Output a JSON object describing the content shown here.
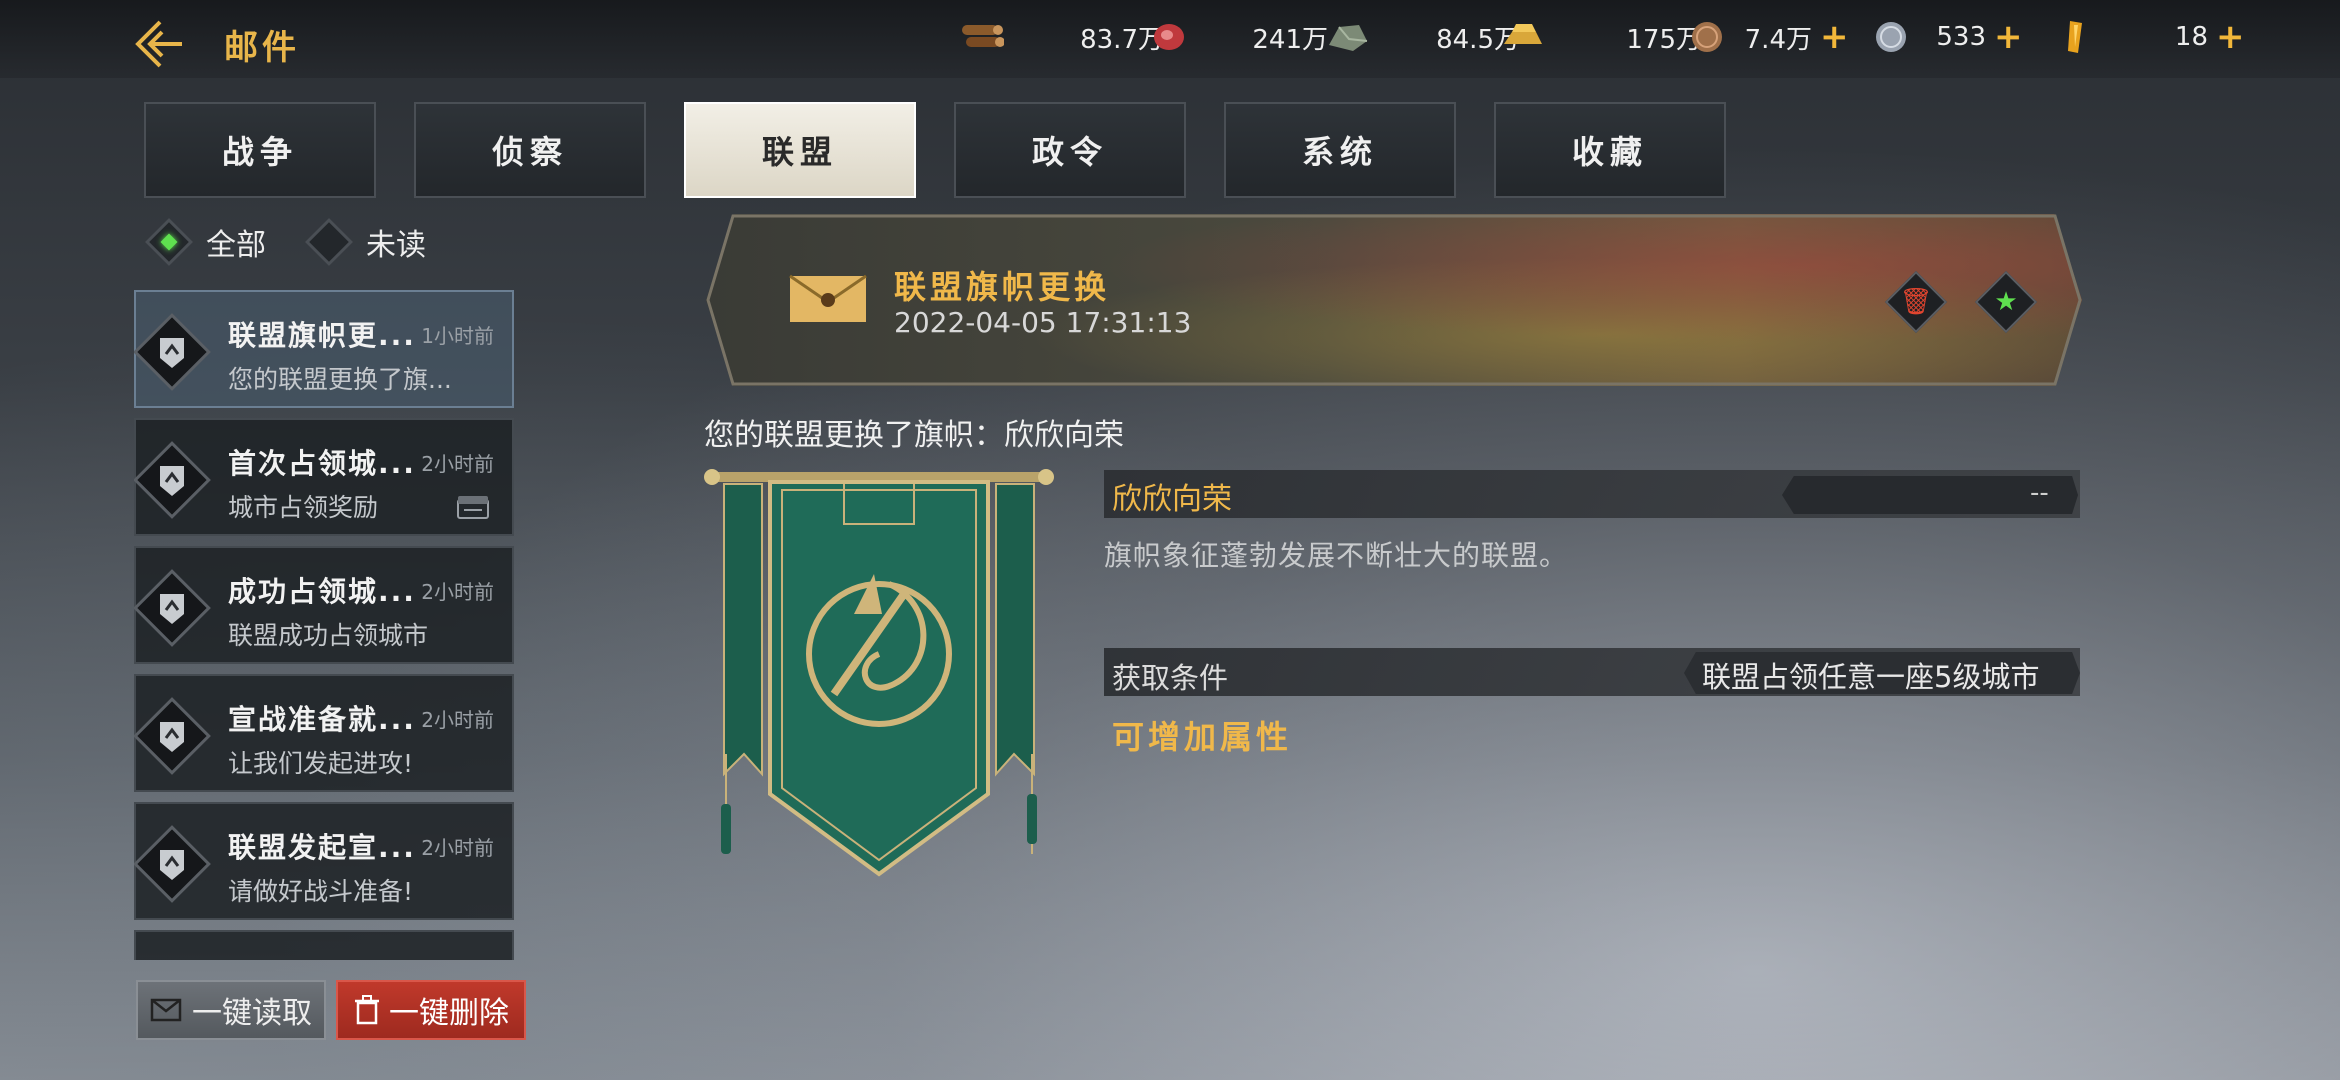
{
  "header": {
    "title": "邮件",
    "resources": [
      {
        "icon": "wood-icon",
        "value": "83.7万",
        "plus": ""
      },
      {
        "icon": "meat-icon",
        "value": "241万",
        "plus": ""
      },
      {
        "icon": "stone-icon",
        "value": "84.5万",
        "plus": ""
      },
      {
        "icon": "gold-bar-icon",
        "value": "175万",
        "plus": ""
      },
      {
        "icon": "coin-icon",
        "value": "7.4万",
        "plus": "+"
      },
      {
        "icon": "silver-coin-icon",
        "value": "533",
        "plus": "+"
      },
      {
        "icon": "crystal-icon",
        "value": "18",
        "plus": "+"
      }
    ]
  },
  "tabs": [
    {
      "label": "战争"
    },
    {
      "label": "侦察"
    },
    {
      "label": "联盟",
      "active": true
    },
    {
      "label": "政令"
    },
    {
      "label": "系统"
    },
    {
      "label": "收藏"
    }
  ],
  "filters": {
    "all": "全部",
    "unread": "未读"
  },
  "mail_list": [
    {
      "title": "联盟旗帜更...",
      "time": "1小时前",
      "subtitle": "您的联盟更换了旗...",
      "selected": true
    },
    {
      "title": "首次占领城...",
      "time": "2小时前",
      "subtitle": "城市占领奖励",
      "attachment": true
    },
    {
      "title": "成功占领城...",
      "time": "2小时前",
      "subtitle": "联盟成功占领城市"
    },
    {
      "title": "宣战准备就...",
      "time": "2小时前",
      "subtitle": "让我们发起进攻!"
    },
    {
      "title": "联盟发起宣...",
      "time": "2小时前",
      "subtitle": "请做好战斗准备!"
    }
  ],
  "actions": {
    "read_all": "一键读取",
    "delete_all": "一键删除"
  },
  "detail": {
    "title": "联盟旗帜更换",
    "date": "2022-04-05 17:31:13",
    "body": "您的联盟更换了旗帜：欣欣向荣",
    "flag_name": "欣欣向荣",
    "flag_value": "--",
    "flag_desc": "旗帜象征蓬勃发展不断壮大的联盟。",
    "condition_label": "获取条件",
    "condition_value": "联盟占领任意一座5级城市",
    "attr_title": "可增加属性"
  },
  "colors": {
    "accent": "#e8b54a",
    "active_tab": "#f2efe6",
    "delete": "#c0392b",
    "unread_dot": "#5fe04f",
    "banner": "#1f6b58"
  }
}
